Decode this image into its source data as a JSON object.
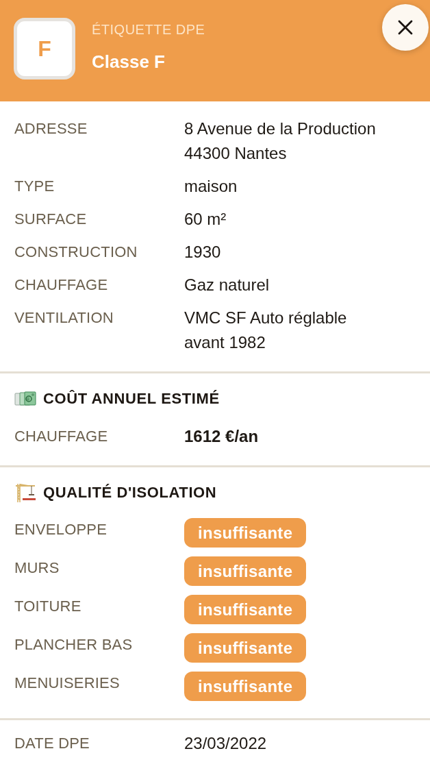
{
  "header": {
    "badge": "F",
    "eyebrow": "ÉTIQUETTE DPE",
    "title": "Classe F"
  },
  "details": [
    {
      "label": "ADRESSE",
      "lines": [
        "8 Avenue de la Production",
        "44300 Nantes"
      ]
    },
    {
      "label": "TYPE",
      "lines": [
        "maison"
      ]
    },
    {
      "label": "SURFACE",
      "lines": [
        "60 m²"
      ]
    },
    {
      "label": "CONSTRUCTION",
      "lines": [
        "1930"
      ]
    },
    {
      "label": "CHAUFFAGE",
      "lines": [
        "Gaz naturel"
      ]
    },
    {
      "label": "VENTILATION",
      "lines": [
        "VMC SF Auto réglable",
        "avant 1982"
      ]
    }
  ],
  "cost": {
    "heading": "COÛT ANNUEL ESTIMÉ",
    "rows": [
      {
        "label": "CHAUFFAGE",
        "value": "1612 €/an"
      }
    ]
  },
  "insulation": {
    "heading": "QUALITÉ D'ISOLATION",
    "rows": [
      {
        "label": "ENVELOPPE",
        "rating": "insuffisante"
      },
      {
        "label": "MURS",
        "rating": "insuffisante"
      },
      {
        "label": "TOITURE",
        "rating": "insuffisante"
      },
      {
        "label": "PLANCHER BAS",
        "rating": "insuffisante"
      },
      {
        "label": "MENUISERIES",
        "rating": "insuffisante"
      }
    ]
  },
  "dpe_date": {
    "label": "DATE DPE",
    "value": "23/03/2022"
  }
}
